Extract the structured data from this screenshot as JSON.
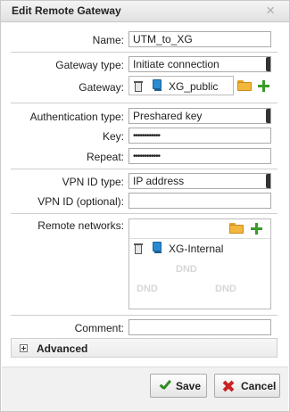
{
  "dialog": {
    "title": "Edit Remote Gateway",
    "close_glyph": "×"
  },
  "fields": {
    "name": {
      "label": "Name:",
      "value": "UTM_to_XG"
    },
    "gateway_type": {
      "label": "Gateway type:",
      "value": "Initiate connection"
    },
    "gateway": {
      "label": "Gateway:",
      "value": "XG_public"
    },
    "authentication_type": {
      "label": "Authentication type:",
      "value": "Preshared key"
    },
    "key": {
      "label": "Key:",
      "value": "••••••••••••"
    },
    "repeat": {
      "label": "Repeat:",
      "value": "••••••••••••"
    },
    "vpn_id_type": {
      "label": "VPN ID type:",
      "value": "IP address"
    },
    "vpn_id": {
      "label": "VPN ID (optional):",
      "value": ""
    },
    "remote_networks": {
      "label": "Remote networks:",
      "items": [
        "XG-Internal"
      ],
      "dnd_text": "DND"
    },
    "comment": {
      "label": "Comment:",
      "value": ""
    }
  },
  "advanced": {
    "label": "Advanced"
  },
  "buttons": {
    "save": "Save",
    "cancel": "Cancel"
  },
  "icons": {
    "trash": "trash-icon",
    "network": "network-icon",
    "folder": "folder-icon",
    "add": "plus-icon",
    "save": "checkmark-icon",
    "cancel": "x-icon",
    "expand": "expand-icon"
  },
  "colors": {
    "add_green": "#3a9a2a",
    "cancel_red": "#cc2222",
    "network_blue": "#2a8bd1",
    "folder_orange": "#f3b73e"
  }
}
